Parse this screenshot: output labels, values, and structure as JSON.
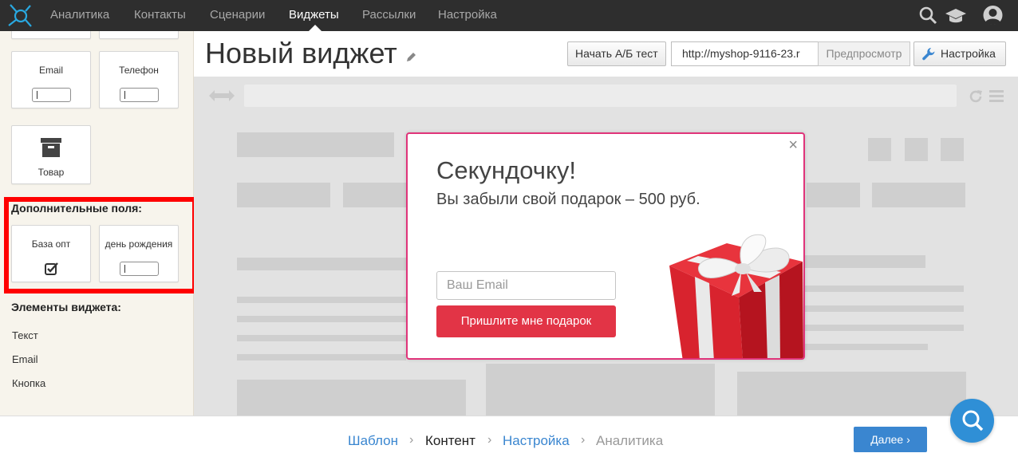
{
  "nav": {
    "items": [
      {
        "label": "Аналитика",
        "active": false
      },
      {
        "label": "Контакты",
        "active": false
      },
      {
        "label": "Сценарии",
        "active": false
      },
      {
        "label": "Виджеты",
        "active": true
      },
      {
        "label": "Рассылки",
        "active": false
      },
      {
        "label": "Настройка",
        "active": false
      }
    ],
    "icons": [
      "search-icon",
      "graduation-cap-icon",
      "user-avatar-icon"
    ]
  },
  "sidebar": {
    "fields": [
      {
        "label": "Email",
        "control": "input"
      },
      {
        "label": "Телефон",
        "control": "input"
      },
      {
        "label": "Товар",
        "control": "box-icon"
      }
    ],
    "extra_title": "Дополнительные поля:",
    "extra_fields": [
      {
        "label": "База опт",
        "control": "checkbox"
      },
      {
        "label": "день рождения",
        "control": "input"
      }
    ],
    "elements_title": "Элементы виджета:",
    "elements": [
      "Текст",
      "Email",
      "Кнопка"
    ]
  },
  "header": {
    "title": "Новый виджет",
    "ab_test_label": "Начать А/Б тест",
    "url_value": "http://myshop-9116-23.r",
    "preview_label": "Предпросмотр",
    "settings_label": "Настройка"
  },
  "popup": {
    "title": "Секундочку!",
    "subtitle": "Вы забыли свой подарок – 500 руб.",
    "email_placeholder": "Ваш Email",
    "button_label": "Пришлите мне подарок",
    "close_symbol": "×"
  },
  "footer": {
    "steps": [
      {
        "label": "Шаблон",
        "state": "link"
      },
      {
        "label": "Контент",
        "state": "current"
      },
      {
        "label": "Настройка",
        "state": "link"
      },
      {
        "label": "Аналитика",
        "state": "disabled"
      }
    ],
    "next_label": "Далее"
  },
  "colors": {
    "nav_bg": "#2e2e2e",
    "accent_blue": "#3a86d0",
    "popup_border": "#e0347a",
    "popup_button": "#e23446",
    "highlight": "#ff0000",
    "sidebar_bg": "#f7f4ec"
  }
}
